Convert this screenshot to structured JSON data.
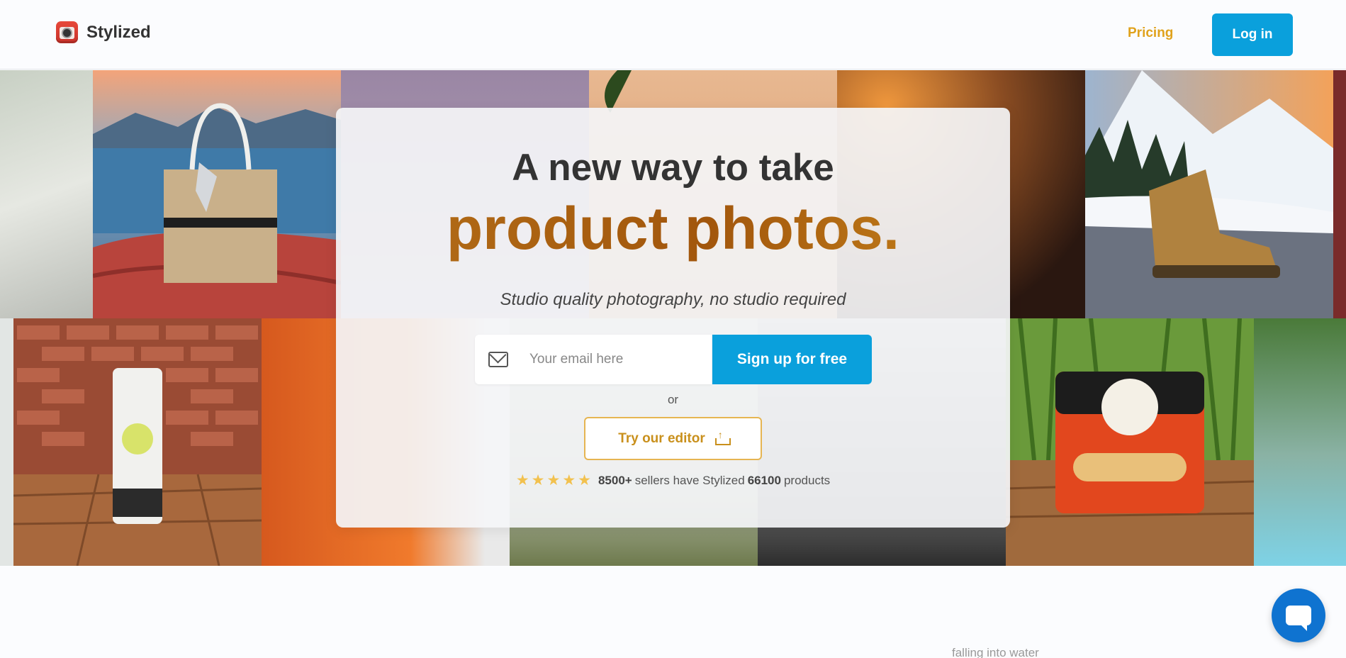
{
  "header": {
    "brand_name": "Stylized",
    "pricing_label": "Pricing",
    "login_label": "Log in"
  },
  "hero": {
    "title_line1": "A new way to take",
    "title_line2": "product photos.",
    "subtitle": "Studio quality photography, no studio required",
    "email_placeholder": "Your email here",
    "signup_label": "Sign up for free",
    "or_label": "or",
    "editor_label": "Try our editor",
    "rating_stars": 5,
    "sellers_count": "8500+",
    "sellers_text_mid": "sellers have Stylized",
    "products_count": "66100",
    "products_text": "products"
  },
  "bottom": {
    "caption": "falling into water"
  },
  "colors": {
    "accent_blue": "#0aa0dc",
    "gold": "#e0a21c",
    "brown_gradient": "#b96d14"
  },
  "icons": [
    "camera-logo-icon",
    "mail-icon",
    "upload-icon",
    "star-icon",
    "chat-icon"
  ]
}
